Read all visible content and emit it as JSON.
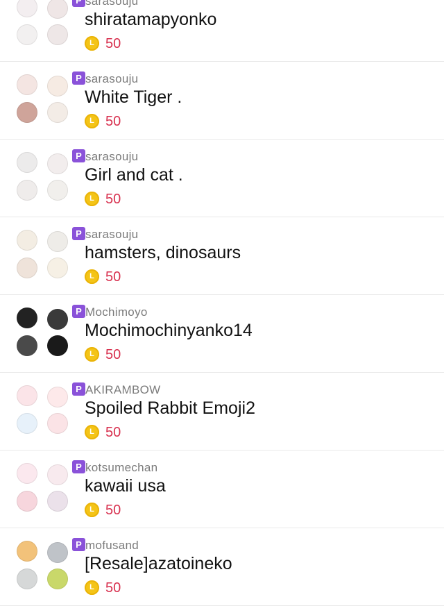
{
  "coin_symbol": "L",
  "badge_label": "P",
  "colors": {
    "badge": "#8a52d9",
    "price": "#d8314f",
    "coin": "#f4c417"
  },
  "items": [
    {
      "author": "sarasouju",
      "title": "shiratamapyonko",
      "price": "50",
      "thumb_palette": [
        "#f3eef0",
        "#efe6e6",
        "#f2f0f0",
        "#eee7e7"
      ]
    },
    {
      "author": "sarasouju",
      "title": "White Tiger .",
      "price": "50",
      "thumb_palette": [
        "#f4e5e2",
        "#f6ebe3",
        "#cfa49a",
        "#f3ece6"
      ]
    },
    {
      "author": "sarasouju",
      "title": "Girl and cat .",
      "price": "50",
      "thumb_palette": [
        "#ecebeb",
        "#f2eded",
        "#efeceb",
        "#f1efec"
      ]
    },
    {
      "author": "sarasouju",
      "title": "hamsters, dinosaurs",
      "price": "50",
      "thumb_palette": [
        "#f3ede3",
        "#eeece8",
        "#efe3da",
        "#f6f0e5"
      ]
    },
    {
      "author": "Mochimoyo",
      "title": "Mochimochinyanko14",
      "price": "50",
      "thumb_palette": [
        "#222222",
        "#3a3a3a",
        "#4a4a4a",
        "#1a1a1a"
      ]
    },
    {
      "author": "AKIRAMBOW",
      "title": "Spoiled Rabbit Emoji2",
      "price": "50",
      "thumb_palette": [
        "#fbe4e8",
        "#fde9ea",
        "#e7f1fa",
        "#fbe3e6"
      ]
    },
    {
      "author": "kotsumechan",
      "title": "kawaii usa",
      "price": "50",
      "thumb_palette": [
        "#fbe8ee",
        "#f8eaee",
        "#f7d6dd",
        "#ebe1ea"
      ]
    },
    {
      "author": "mofusand",
      "title": "[Resale]azatoineko",
      "price": "50",
      "thumb_palette": [
        "#f2c27a",
        "#bfc3c8",
        "#d6d8d8",
        "#c9d86a"
      ]
    }
  ]
}
